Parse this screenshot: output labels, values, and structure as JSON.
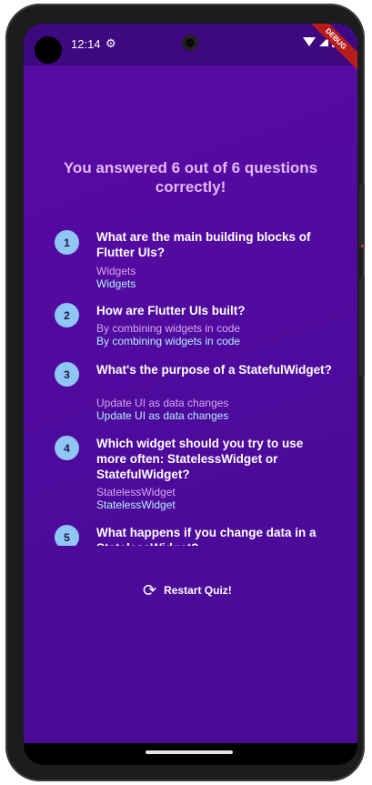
{
  "status_bar": {
    "time": "12:14",
    "debug_label": "DEBUG"
  },
  "result": {
    "title": "You answered 6 out of 6 questions correctly!"
  },
  "summary": [
    {
      "index": "1",
      "question": "What are the main building blocks of Flutter UIs?",
      "user_answer": "Widgets",
      "correct_answer": "Widgets"
    },
    {
      "index": "2",
      "question": "How are Flutter UIs built?",
      "user_answer": "By combining widgets in code",
      "correct_answer": "By combining widgets in code"
    },
    {
      "index": "3",
      "question": "What's the purpose of a StatefulWidget?",
      "user_answer": "Update UI as data changes",
      "correct_answer": "Update UI as data changes"
    },
    {
      "index": "4",
      "question": "Which widget should you try to use more often: StatelessWidget or StatefulWidget?",
      "user_answer": "StatelessWidget",
      "correct_answer": "StatelessWidget"
    },
    {
      "index": "5",
      "question": "What happens if you change data in a StatelessWidget?",
      "user_answer": "",
      "correct_answer": ""
    }
  ],
  "restart": {
    "label": "Restart Quiz!",
    "icon": "refresh-icon"
  },
  "colors": {
    "background": "#4e0a9c",
    "title": "#e3b8f2",
    "circle": "#8fc6f6",
    "user_answer": "#d6a8ef",
    "correct_answer": "#b6f0ff"
  }
}
